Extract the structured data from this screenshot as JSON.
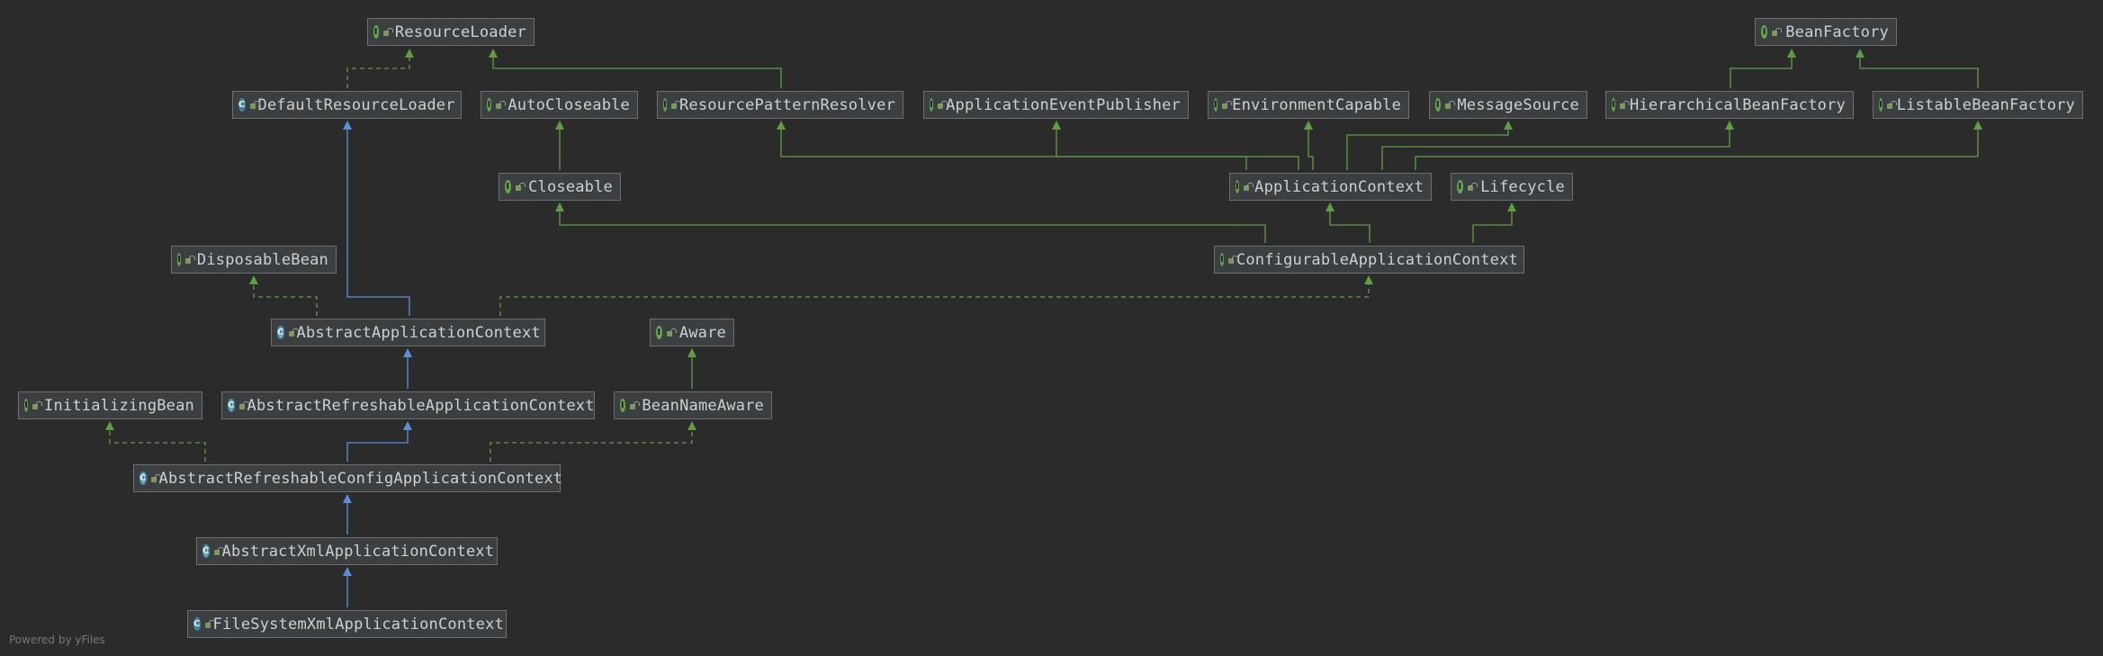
{
  "nodes": [
    {
      "id": "ResourceLoader",
      "label": "ResourceLoader",
      "kind": "interface"
    },
    {
      "id": "BeanFactory",
      "label": "BeanFactory",
      "kind": "interface"
    },
    {
      "id": "DefaultResourceLoader",
      "label": "DefaultResourceLoader",
      "kind": "class"
    },
    {
      "id": "AutoCloseable",
      "label": "AutoCloseable",
      "kind": "interface"
    },
    {
      "id": "ResourcePatternResolver",
      "label": "ResourcePatternResolver",
      "kind": "interface"
    },
    {
      "id": "ApplicationEventPublisher",
      "label": "ApplicationEventPublisher",
      "kind": "interface"
    },
    {
      "id": "EnvironmentCapable",
      "label": "EnvironmentCapable",
      "kind": "interface"
    },
    {
      "id": "MessageSource",
      "label": "MessageSource",
      "kind": "interface"
    },
    {
      "id": "HierarchicalBeanFactory",
      "label": "HierarchicalBeanFactory",
      "kind": "interface"
    },
    {
      "id": "ListableBeanFactory",
      "label": "ListableBeanFactory",
      "kind": "interface"
    },
    {
      "id": "Closeable",
      "label": "Closeable",
      "kind": "interface"
    },
    {
      "id": "ApplicationContext",
      "label": "ApplicationContext",
      "kind": "interface"
    },
    {
      "id": "Lifecycle",
      "label": "Lifecycle",
      "kind": "interface"
    },
    {
      "id": "DisposableBean",
      "label": "DisposableBean",
      "kind": "interface"
    },
    {
      "id": "ConfigurableApplicationContext",
      "label": "ConfigurableApplicationContext",
      "kind": "interface"
    },
    {
      "id": "AbstractApplicationContext",
      "label": "AbstractApplicationContext",
      "kind": "abstract"
    },
    {
      "id": "Aware",
      "label": "Aware",
      "kind": "interface"
    },
    {
      "id": "InitializingBean",
      "label": "InitializingBean",
      "kind": "interface"
    },
    {
      "id": "AbstractRefreshableApplicationContext",
      "label": "AbstractRefreshableApplicationContext",
      "kind": "abstract"
    },
    {
      "id": "BeanNameAware",
      "label": "BeanNameAware",
      "kind": "interface"
    },
    {
      "id": "AbstractRefreshableConfigApplicationContext",
      "label": "AbstractRefreshableConfigApplicationContext",
      "kind": "abstract"
    },
    {
      "id": "AbstractXmlApplicationContext",
      "label": "AbstractXmlApplicationContext",
      "kind": "abstract"
    },
    {
      "id": "FileSystemXmlApplicationContext",
      "label": "FileSystemXmlApplicationContext",
      "kind": "class"
    }
  ],
  "edges": [
    {
      "from": "DefaultResourceLoader",
      "to": "ResourceLoader",
      "type": "implements"
    },
    {
      "from": "ResourcePatternResolver",
      "to": "ResourceLoader",
      "type": "extends-interface"
    },
    {
      "from": "HierarchicalBeanFactory",
      "to": "BeanFactory",
      "type": "extends-interface"
    },
    {
      "from": "ListableBeanFactory",
      "to": "BeanFactory",
      "type": "extends-interface"
    },
    {
      "from": "Closeable",
      "to": "AutoCloseable",
      "type": "extends-interface"
    },
    {
      "from": "ApplicationContext",
      "to": "ResourcePatternResolver",
      "type": "extends-interface"
    },
    {
      "from": "ApplicationContext",
      "to": "ApplicationEventPublisher",
      "type": "extends-interface"
    },
    {
      "from": "ApplicationContext",
      "to": "EnvironmentCapable",
      "type": "extends-interface"
    },
    {
      "from": "ApplicationContext",
      "to": "MessageSource",
      "type": "extends-interface"
    },
    {
      "from": "ApplicationContext",
      "to": "HierarchicalBeanFactory",
      "type": "extends-interface"
    },
    {
      "from": "ApplicationContext",
      "to": "ListableBeanFactory",
      "type": "extends-interface"
    },
    {
      "from": "ConfigurableApplicationContext",
      "to": "Closeable",
      "type": "extends-interface"
    },
    {
      "from": "ConfigurableApplicationContext",
      "to": "ApplicationContext",
      "type": "extends-interface"
    },
    {
      "from": "ConfigurableApplicationContext",
      "to": "Lifecycle",
      "type": "extends-interface"
    },
    {
      "from": "AbstractApplicationContext",
      "to": "DisposableBean",
      "type": "implements"
    },
    {
      "from": "AbstractApplicationContext",
      "to": "DefaultResourceLoader",
      "type": "extends-class"
    },
    {
      "from": "AbstractApplicationContext",
      "to": "ConfigurableApplicationContext",
      "type": "implements"
    },
    {
      "from": "AbstractRefreshableApplicationContext",
      "to": "AbstractApplicationContext",
      "type": "extends-class"
    },
    {
      "from": "BeanNameAware",
      "to": "Aware",
      "type": "extends-interface"
    },
    {
      "from": "AbstractRefreshableConfigApplicationContext",
      "to": "InitializingBean",
      "type": "implements"
    },
    {
      "from": "AbstractRefreshableConfigApplicationContext",
      "to": "AbstractRefreshableApplicationContext",
      "type": "extends-class"
    },
    {
      "from": "AbstractRefreshableConfigApplicationContext",
      "to": "BeanNameAware",
      "type": "implements"
    },
    {
      "from": "AbstractXmlApplicationContext",
      "to": "AbstractRefreshableConfigApplicationContext",
      "type": "extends-class"
    },
    {
      "from": "FileSystemXmlApplicationContext",
      "to": "AbstractXmlApplicationContext",
      "type": "extends-class"
    }
  ],
  "colors": {
    "background": "#2b2b2b",
    "node_fill": "#3c3f41",
    "node_border": "#6e6e6e",
    "interface_edge": "#5f9e45",
    "class_edge": "#5b8fdb"
  },
  "footer": "Powered by yFiles"
}
